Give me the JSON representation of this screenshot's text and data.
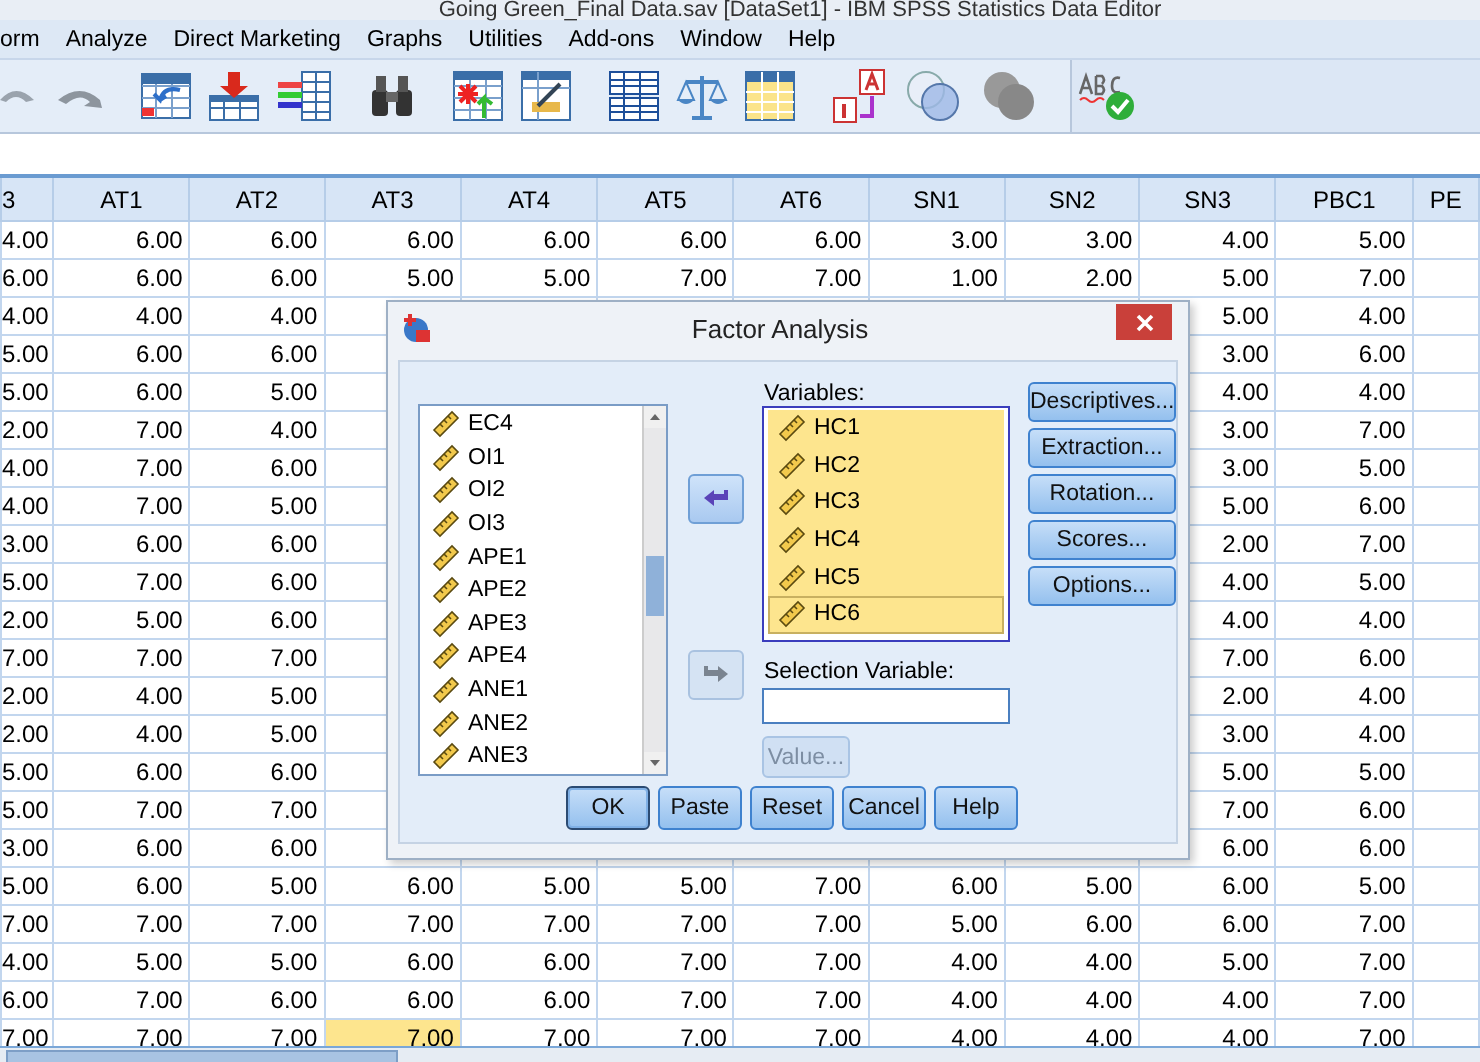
{
  "window": {
    "title": "Going Green_Final Data.sav [DataSet1] - IBM SPSS Statistics Data Editor"
  },
  "menu": [
    "orm",
    "Analyze",
    "Direct Marketing",
    "Graphs",
    "Utilities",
    "Add-ons",
    "Window",
    "Help"
  ],
  "table": {
    "columns": [
      "3",
      "AT1",
      "AT2",
      "AT3",
      "AT4",
      "AT5",
      "AT6",
      "SN1",
      "SN2",
      "SN3",
      "PBC1",
      "PE"
    ],
    "rows": [
      {
        "cells": [
          {
            "text": "4.00",
            "selected": false
          },
          {
            "text": "6.00",
            "selected": false
          },
          {
            "text": "6.00",
            "selected": false
          },
          {
            "text": "6.00",
            "selected": false
          },
          {
            "text": "6.00",
            "selected": false
          },
          {
            "text": "6.00",
            "selected": false
          },
          {
            "text": "6.00",
            "selected": false
          },
          {
            "text": "3.00",
            "selected": false
          },
          {
            "text": "3.00",
            "selected": false
          },
          {
            "text": "4.00",
            "selected": false
          },
          {
            "text": "5.00",
            "selected": false
          }
        ]
      },
      {
        "cells": [
          {
            "text": "6.00",
            "selected": false
          },
          {
            "text": "6.00",
            "selected": false
          },
          {
            "text": "6.00",
            "selected": false
          },
          {
            "text": "5.00",
            "selected": false
          },
          {
            "text": "5.00",
            "selected": false
          },
          {
            "text": "7.00",
            "selected": false
          },
          {
            "text": "7.00",
            "selected": false
          },
          {
            "text": "1.00",
            "selected": false
          },
          {
            "text": "2.00",
            "selected": false
          },
          {
            "text": "5.00",
            "selected": false
          },
          {
            "text": "7.00",
            "selected": false
          }
        ]
      },
      {
        "cells": [
          {
            "text": "4.00",
            "selected": false
          },
          {
            "text": "4.00",
            "selected": false
          },
          {
            "text": "4.00",
            "selected": false
          },
          null,
          null,
          null,
          null,
          null,
          null,
          {
            "text": "5.00",
            "selected": false
          },
          {
            "text": "4.00",
            "selected": false
          }
        ]
      },
      {
        "cells": [
          {
            "text": "5.00",
            "selected": false
          },
          {
            "text": "6.00",
            "selected": false
          },
          {
            "text": "6.00",
            "selected": false
          },
          null,
          null,
          null,
          null,
          null,
          null,
          {
            "text": "3.00",
            "selected": false
          },
          {
            "text": "6.00",
            "selected": false
          }
        ]
      },
      {
        "cells": [
          {
            "text": "5.00",
            "selected": false
          },
          {
            "text": "6.00",
            "selected": false
          },
          {
            "text": "5.00",
            "selected": false
          },
          null,
          null,
          null,
          null,
          null,
          null,
          {
            "text": "4.00",
            "selected": false
          },
          {
            "text": "4.00",
            "selected": false
          }
        ]
      },
      {
        "cells": [
          {
            "text": "2.00",
            "selected": false
          },
          {
            "text": "7.00",
            "selected": false
          },
          {
            "text": "4.00",
            "selected": false
          },
          null,
          null,
          null,
          null,
          null,
          null,
          {
            "text": "3.00",
            "selected": false
          },
          {
            "text": "7.00",
            "selected": false
          }
        ]
      },
      {
        "cells": [
          {
            "text": "4.00",
            "selected": false
          },
          {
            "text": "7.00",
            "selected": false
          },
          {
            "text": "6.00",
            "selected": false
          },
          null,
          null,
          null,
          null,
          null,
          null,
          {
            "text": "3.00",
            "selected": false
          },
          {
            "text": "5.00",
            "selected": false
          }
        ]
      },
      {
        "cells": [
          {
            "text": "4.00",
            "selected": false
          },
          {
            "text": "7.00",
            "selected": false
          },
          {
            "text": "5.00",
            "selected": false
          },
          null,
          null,
          null,
          null,
          null,
          null,
          {
            "text": "5.00",
            "selected": false
          },
          {
            "text": "6.00",
            "selected": false
          }
        ]
      },
      {
        "cells": [
          {
            "text": "3.00",
            "selected": false
          },
          {
            "text": "6.00",
            "selected": false
          },
          {
            "text": "6.00",
            "selected": false
          },
          null,
          null,
          null,
          null,
          null,
          null,
          {
            "text": "2.00",
            "selected": false
          },
          {
            "text": "7.00",
            "selected": false
          }
        ]
      },
      {
        "cells": [
          {
            "text": "5.00",
            "selected": false
          },
          {
            "text": "7.00",
            "selected": false
          },
          {
            "text": "6.00",
            "selected": false
          },
          null,
          null,
          null,
          null,
          null,
          null,
          {
            "text": "4.00",
            "selected": false
          },
          {
            "text": "5.00",
            "selected": false
          }
        ]
      },
      {
        "cells": [
          {
            "text": "2.00",
            "selected": false
          },
          {
            "text": "5.00",
            "selected": false
          },
          {
            "text": "6.00",
            "selected": false
          },
          null,
          null,
          null,
          null,
          null,
          null,
          {
            "text": "4.00",
            "selected": false
          },
          {
            "text": "4.00",
            "selected": false
          }
        ]
      },
      {
        "cells": [
          {
            "text": "7.00",
            "selected": false
          },
          {
            "text": "7.00",
            "selected": false
          },
          {
            "text": "7.00",
            "selected": false
          },
          null,
          null,
          null,
          null,
          null,
          null,
          {
            "text": "7.00",
            "selected": false
          },
          {
            "text": "6.00",
            "selected": false
          }
        ]
      },
      {
        "cells": [
          {
            "text": "2.00",
            "selected": false
          },
          {
            "text": "4.00",
            "selected": false
          },
          {
            "text": "5.00",
            "selected": false
          },
          null,
          null,
          null,
          null,
          null,
          null,
          {
            "text": "2.00",
            "selected": false
          },
          {
            "text": "4.00",
            "selected": false
          }
        ]
      },
      {
        "cells": [
          {
            "text": "2.00",
            "selected": false
          },
          {
            "text": "4.00",
            "selected": false
          },
          {
            "text": "5.00",
            "selected": false
          },
          null,
          null,
          null,
          null,
          null,
          null,
          {
            "text": "3.00",
            "selected": false
          },
          {
            "text": "4.00",
            "selected": false
          }
        ]
      },
      {
        "cells": [
          {
            "text": "5.00",
            "selected": false
          },
          {
            "text": "6.00",
            "selected": false
          },
          {
            "text": "6.00",
            "selected": false
          },
          null,
          null,
          null,
          null,
          null,
          null,
          {
            "text": "5.00",
            "selected": false
          },
          {
            "text": "5.00",
            "selected": false
          }
        ]
      },
      {
        "cells": [
          {
            "text": "5.00",
            "selected": false
          },
          {
            "text": "7.00",
            "selected": false
          },
          {
            "text": "7.00",
            "selected": false
          },
          null,
          null,
          null,
          null,
          null,
          null,
          {
            "text": "7.00",
            "selected": false
          },
          {
            "text": "6.00",
            "selected": false
          }
        ]
      },
      {
        "cells": [
          {
            "text": "3.00",
            "selected": false
          },
          {
            "text": "6.00",
            "selected": false
          },
          {
            "text": "6.00",
            "selected": false
          },
          null,
          null,
          null,
          null,
          null,
          null,
          {
            "text": "6.00",
            "selected": false
          },
          {
            "text": "6.00",
            "selected": false
          }
        ]
      },
      {
        "cells": [
          {
            "text": "5.00",
            "selected": false
          },
          {
            "text": "6.00",
            "selected": false
          },
          {
            "text": "5.00",
            "selected": false
          },
          {
            "text": "6.00",
            "selected": false
          },
          {
            "text": "5.00",
            "selected": false
          },
          {
            "text": "5.00",
            "selected": false
          },
          {
            "text": "7.00",
            "selected": false
          },
          {
            "text": "6.00",
            "selected": false
          },
          {
            "text": "5.00",
            "selected": false
          },
          {
            "text": "6.00",
            "selected": false
          },
          {
            "text": "5.00",
            "selected": false
          }
        ]
      },
      {
        "cells": [
          {
            "text": "7.00",
            "selected": false
          },
          {
            "text": "7.00",
            "selected": false
          },
          {
            "text": "7.00",
            "selected": false
          },
          {
            "text": "7.00",
            "selected": false
          },
          {
            "text": "7.00",
            "selected": false
          },
          {
            "text": "7.00",
            "selected": false
          },
          {
            "text": "7.00",
            "selected": false
          },
          {
            "text": "5.00",
            "selected": false
          },
          {
            "text": "6.00",
            "selected": false
          },
          {
            "text": "6.00",
            "selected": false
          },
          {
            "text": "7.00",
            "selected": false
          }
        ]
      },
      {
        "cells": [
          {
            "text": "4.00",
            "selected": false
          },
          {
            "text": "5.00",
            "selected": false
          },
          {
            "text": "5.00",
            "selected": false
          },
          {
            "text": "6.00",
            "selected": false
          },
          {
            "text": "6.00",
            "selected": false
          },
          {
            "text": "7.00",
            "selected": false
          },
          {
            "text": "7.00",
            "selected": false
          },
          {
            "text": "4.00",
            "selected": false
          },
          {
            "text": "4.00",
            "selected": false
          },
          {
            "text": "5.00",
            "selected": false
          },
          {
            "text": "7.00",
            "selected": false
          }
        ]
      },
      {
        "cells": [
          {
            "text": "6.00",
            "selected": false
          },
          {
            "text": "7.00",
            "selected": false
          },
          {
            "text": "6.00",
            "selected": false
          },
          {
            "text": "6.00",
            "selected": false
          },
          {
            "text": "6.00",
            "selected": false
          },
          {
            "text": "7.00",
            "selected": false
          },
          {
            "text": "7.00",
            "selected": false
          },
          {
            "text": "4.00",
            "selected": false
          },
          {
            "text": "4.00",
            "selected": false
          },
          {
            "text": "4.00",
            "selected": false
          },
          {
            "text": "7.00",
            "selected": false
          }
        ]
      },
      {
        "cells": [
          {
            "text": "7.00",
            "selected": false
          },
          {
            "text": "7.00",
            "selected": false
          },
          {
            "text": "7.00",
            "selected": false
          },
          {
            "text": "7.00",
            "selected": true
          },
          {
            "text": "7.00",
            "selected": false
          },
          {
            "text": "7.00",
            "selected": false
          },
          {
            "text": "7.00",
            "selected": false
          },
          {
            "text": "4.00",
            "selected": false
          },
          {
            "text": "4.00",
            "selected": false
          },
          {
            "text": "4.00",
            "selected": false
          },
          {
            "text": "7.00",
            "selected": false
          }
        ]
      }
    ]
  },
  "dialog": {
    "title": "Factor Analysis",
    "source_list": [
      {
        "label": "EC4"
      },
      {
        "label": "OI1"
      },
      {
        "label": "OI2"
      },
      {
        "label": "OI3"
      },
      {
        "label": "APE1"
      },
      {
        "label": "APE2"
      },
      {
        "label": "APE3"
      },
      {
        "label": "APE4"
      },
      {
        "label": "ANE1"
      },
      {
        "label": "ANE2"
      },
      {
        "label": "ANE3"
      }
    ],
    "variables_label": "Variables:",
    "variables": [
      {
        "label": "HC1",
        "selected": true,
        "focused": false
      },
      {
        "label": "HC2",
        "selected": true,
        "focused": false
      },
      {
        "label": "HC3",
        "selected": true,
        "focused": false
      },
      {
        "label": "HC4",
        "selected": true,
        "focused": false
      },
      {
        "label": "HC5",
        "selected": true,
        "focused": false
      },
      {
        "label": "HC6",
        "selected": true,
        "focused": true
      }
    ],
    "move_buttons": [
      {
        "disabled": false
      },
      {
        "disabled": true
      }
    ],
    "selection_label": "Selection Variable:",
    "value_button": {
      "label": "Value...",
      "disabled": true
    },
    "side_buttons": [
      "Descriptives...",
      "Extraction...",
      "Rotation...",
      "Scores...",
      "Options..."
    ],
    "buttons": [
      {
        "label": "OK",
        "default": true
      },
      {
        "label": "Paste",
        "default": false
      },
      {
        "label": "Reset",
        "default": false
      },
      {
        "label": "Cancel",
        "default": false
      },
      {
        "label": "Help",
        "default": false
      }
    ]
  }
}
